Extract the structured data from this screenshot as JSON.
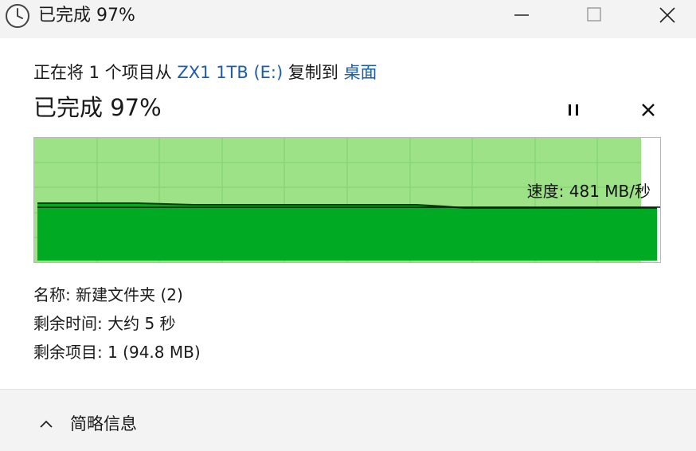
{
  "window": {
    "title": "已完成 97%",
    "icons": {
      "app": "clock-icon",
      "minimize": "minimize-icon",
      "maximize": "maximize-icon",
      "close": "close-icon"
    }
  },
  "copy": {
    "prefix": "正在将 1 个项目从 ",
    "source": "ZX1 1TB (E:)",
    "middle": " 复制到 ",
    "destination": "桌面",
    "link_color": "#1b5ea8"
  },
  "progress": {
    "status": "已完成 97%",
    "percent": 97,
    "pause_icon": "pause-icon",
    "cancel_icon": "close-icon"
  },
  "graph": {
    "speed_label": "速度: 481 MB/秒",
    "fill_color": "#00aa22",
    "done_color": "#9ee288",
    "grid_color": "#7fd36a"
  },
  "details": {
    "name": "名称: 新建文件夹 (2)",
    "time_left": "剩余时间: 大约 5 秒",
    "items_left": "剩余项目: 1 (94.8 MB)"
  },
  "footer": {
    "toggle_label": "简略信息",
    "toggle_icon": "chevron-up-icon"
  }
}
